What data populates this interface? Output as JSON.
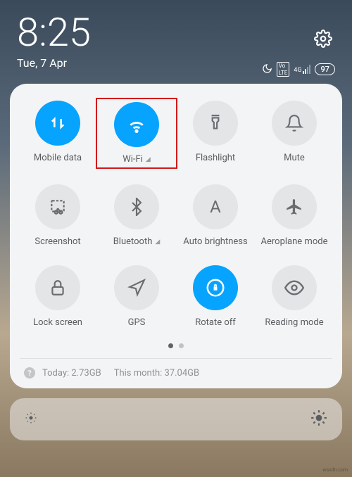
{
  "statusBar": {
    "time": "8:25",
    "date": "Tue, 7 Apr",
    "battery": "97",
    "network": "4G"
  },
  "tiles": {
    "mobileData": {
      "label": "Mobile data"
    },
    "wifi": {
      "label": "Wi-Fi"
    },
    "flashlight": {
      "label": "Flashlight"
    },
    "mute": {
      "label": "Mute"
    },
    "screenshot": {
      "label": "Screenshot"
    },
    "bluetooth": {
      "label": "Bluetooth"
    },
    "autoBrightness": {
      "label": "Auto brightness"
    },
    "aeroplaneMode": {
      "label": "Aeroplane mode"
    },
    "lockScreen": {
      "label": "Lock screen"
    },
    "gps": {
      "label": "GPS"
    },
    "rotateOff": {
      "label": "Rotate off"
    },
    "readingMode": {
      "label": "Reading mode"
    }
  },
  "dataUsage": {
    "today": "Today: 2.73GB",
    "month": "This month: 37.04GB"
  },
  "watermark": "wsxdn.com"
}
